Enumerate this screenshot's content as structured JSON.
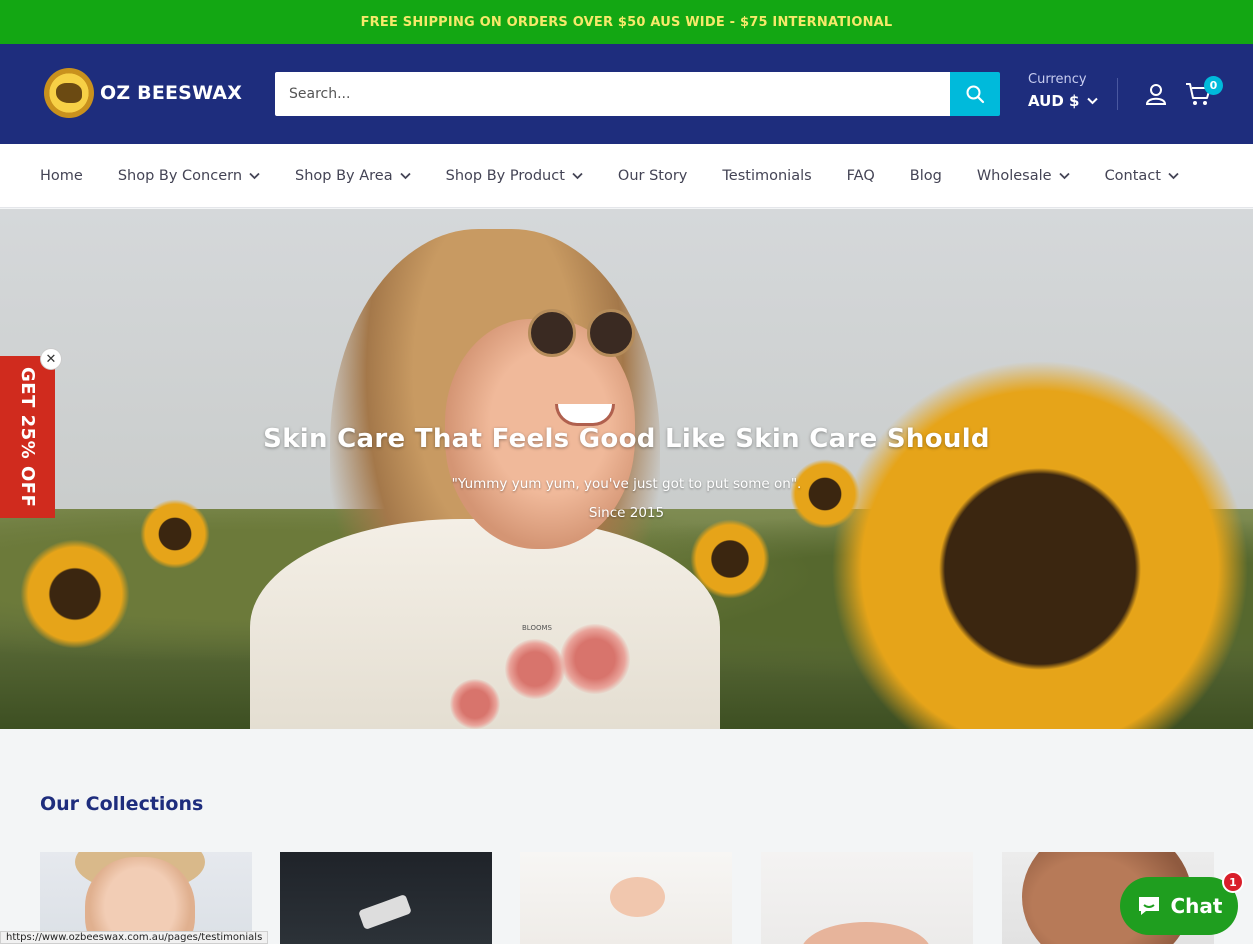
{
  "announcement": {
    "text": "FREE SHIPPING ON ORDERS OVER $50 AUS WIDE - $75 INTERNATIONAL"
  },
  "header": {
    "logo_text": "OZ BEESWAX",
    "search_placeholder": "Search...",
    "currency_label": "Currency",
    "currency_value": "AUD $",
    "cart_count": "0"
  },
  "nav": {
    "items": [
      {
        "label": "Home",
        "dropdown": false
      },
      {
        "label": "Shop By Concern",
        "dropdown": true
      },
      {
        "label": "Shop By Area",
        "dropdown": true
      },
      {
        "label": "Shop By Product",
        "dropdown": true
      },
      {
        "label": "Our Story",
        "dropdown": false
      },
      {
        "label": "Testimonials",
        "dropdown": false
      },
      {
        "label": "FAQ",
        "dropdown": false
      },
      {
        "label": "Blog",
        "dropdown": false
      },
      {
        "label": "Wholesale",
        "dropdown": true
      },
      {
        "label": "Contact",
        "dropdown": true
      }
    ]
  },
  "hero": {
    "title": "Skin Care That Feels Good Like Skin Care Should",
    "subtitle": "\"Yummy yum yum, you've just got to put some on\".",
    "since": "Since 2015",
    "shirt_text": "BLOOMS"
  },
  "promo": {
    "label": "GET 25% OFF",
    "close": "✕"
  },
  "collections": {
    "title": "Our Collections"
  },
  "status_bar": {
    "url": "https://www.ozbeeswax.com.au/pages/testimonials"
  },
  "chat": {
    "label": "Chat",
    "badge": "1"
  },
  "colors": {
    "announcement_bg": "#13a713",
    "announcement_text": "#f6e96a",
    "header_bg": "#1e2d7d",
    "accent": "#00badb",
    "promo_bg": "#d02b1e",
    "chat_bg": "#1f9e1f"
  }
}
